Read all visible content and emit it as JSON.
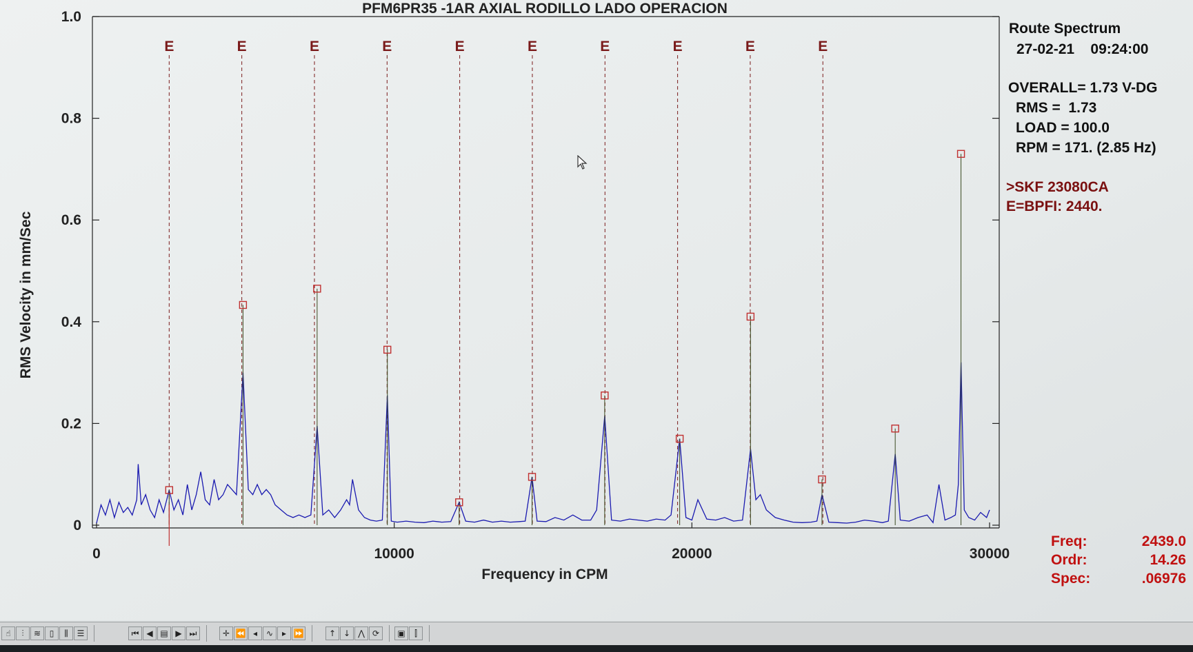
{
  "chart_data": {
    "type": "line",
    "title": "PFM6PR35  -1AR   AXIAL RODILLO LADO OPERACION",
    "xlabel": "Frequency in CPM",
    "ylabel": "RMS Velocity in mm/Sec",
    "xlim": [
      0,
      30000
    ],
    "ylim": [
      0,
      1.0
    ],
    "x_ticks": [
      0,
      10000,
      20000,
      30000
    ],
    "y_ticks": [
      0,
      0.2,
      0.4,
      0.6,
      0.8,
      1.0
    ],
    "x_tick_labels": [
      "0",
      "10000",
      "20000",
      "30000"
    ],
    "y_tick_labels": [
      "0",
      "0.2",
      "0.4",
      "0.6",
      "0.8",
      "1.0"
    ],
    "grid": false,
    "fault_marker_label": "E",
    "fault_frequencies": [
      2440,
      4880,
      7320,
      9760,
      12200,
      14640,
      17080,
      19520,
      21960,
      24400
    ],
    "peaks": [
      {
        "x": 2440,
        "y": 0.069
      },
      {
        "x": 4920,
        "y": 0.433
      },
      {
        "x": 7410,
        "y": 0.465
      },
      {
        "x": 9770,
        "y": 0.345
      },
      {
        "x": 12180,
        "y": 0.045
      },
      {
        "x": 14630,
        "y": 0.095
      },
      {
        "x": 17070,
        "y": 0.255
      },
      {
        "x": 19590,
        "y": 0.17
      },
      {
        "x": 21970,
        "y": 0.41
      },
      {
        "x": 24370,
        "y": 0.09
      },
      {
        "x": 26830,
        "y": 0.19
      },
      {
        "x": 29040,
        "y": 0.73
      }
    ],
    "series": [
      {
        "color": "#1a1ab0",
        "x": [
          0,
          150,
          300,
          450,
          600,
          750,
          900,
          1050,
          1200,
          1350,
          1400,
          1500,
          1650,
          1800,
          1950,
          2100,
          2250,
          2440,
          2600,
          2750,
          2900,
          3050,
          3200,
          3350,
          3500,
          3650,
          3800,
          3950,
          4100,
          4250,
          4400,
          4550,
          4700,
          4920,
          5100,
          5250,
          5400,
          5550,
          5700,
          5850,
          6000,
          6200,
          6400,
          6600,
          6800,
          7000,
          7200,
          7410,
          7600,
          7800,
          8000,
          8200,
          8400,
          8500,
          8600,
          8800,
          9000,
          9200,
          9400,
          9600,
          9770,
          9900,
          10100,
          10400,
          10700,
          11000,
          11300,
          11600,
          11900,
          12180,
          12400,
          12700,
          13000,
          13300,
          13600,
          13900,
          14200,
          14400,
          14630,
          14800,
          15100,
          15400,
          15700,
          16000,
          16300,
          16600,
          16800,
          17070,
          17300,
          17600,
          17900,
          18200,
          18500,
          18800,
          19100,
          19300,
          19590,
          19800,
          20000,
          20200,
          20500,
          20800,
          21100,
          21400,
          21700,
          21970,
          22150,
          22300,
          22500,
          22800,
          23100,
          23400,
          23700,
          24000,
          24200,
          24370,
          24600,
          24900,
          25200,
          25500,
          25800,
          26100,
          26400,
          26600,
          26830,
          27000,
          27300,
          27600,
          27900,
          28100,
          28300,
          28500,
          28700,
          28850,
          28950,
          29040,
          29150,
          29300,
          29500,
          29700,
          29900,
          30000
        ],
        "values": [
          0.004,
          0.04,
          0.02,
          0.05,
          0.015,
          0.045,
          0.025,
          0.035,
          0.02,
          0.05,
          0.12,
          0.04,
          0.06,
          0.03,
          0.015,
          0.05,
          0.025,
          0.069,
          0.03,
          0.05,
          0.02,
          0.08,
          0.03,
          0.06,
          0.105,
          0.05,
          0.04,
          0.09,
          0.05,
          0.06,
          0.08,
          0.07,
          0.06,
          0.3,
          0.07,
          0.06,
          0.08,
          0.06,
          0.07,
          0.06,
          0.04,
          0.03,
          0.02,
          0.015,
          0.02,
          0.015,
          0.02,
          0.195,
          0.02,
          0.03,
          0.015,
          0.03,
          0.05,
          0.04,
          0.09,
          0.03,
          0.015,
          0.01,
          0.008,
          0.01,
          0.255,
          0.008,
          0.006,
          0.008,
          0.006,
          0.005,
          0.008,
          0.006,
          0.007,
          0.045,
          0.008,
          0.006,
          0.01,
          0.006,
          0.008,
          0.006,
          0.007,
          0.008,
          0.095,
          0.008,
          0.007,
          0.015,
          0.01,
          0.02,
          0.01,
          0.01,
          0.03,
          0.215,
          0.01,
          0.008,
          0.012,
          0.01,
          0.008,
          0.012,
          0.01,
          0.02,
          0.17,
          0.015,
          0.01,
          0.05,
          0.012,
          0.01,
          0.015,
          0.008,
          0.01,
          0.15,
          0.05,
          0.06,
          0.03,
          0.015,
          0.01,
          0.006,
          0.005,
          0.006,
          0.008,
          0.06,
          0.006,
          0.005,
          0.004,
          0.006,
          0.01,
          0.008,
          0.005,
          0.008,
          0.14,
          0.01,
          0.008,
          0.015,
          0.02,
          0.005,
          0.08,
          0.01,
          0.015,
          0.02,
          0.08,
          0.32,
          0.03,
          0.015,
          0.01,
          0.025,
          0.015,
          0.03
        ]
      }
    ]
  },
  "info": {
    "heading": "Route Spectrum",
    "datetime": "27-02-21    09:24:00",
    "overall": "OVERALL= 1.73 V-DG",
    "rms": "RMS =  1.73",
    "load": "LOAD = 100.0",
    "rpm": "RPM = 171. (2.85 Hz)",
    "bearing": ">SKF 23080CA",
    "fault_def": "E=BPFI: 2440."
  },
  "cursor": {
    "freq_label": "Freq:",
    "freq_value": "2439.0",
    "ordr_label": "Ordr:",
    "ordr_value": "14.26",
    "spec_label": "Spec:",
    "spec_value": ".06976",
    "x": 2440
  },
  "colors": {
    "spectrum": "#1a1ab0",
    "fault_line": "#7a1a1a",
    "marker": "#c03030",
    "cursor_text": "#c01010",
    "axis": "#222222"
  },
  "toolbar": {
    "groups": [
      [
        "hand-icon",
        "spectrum-icon",
        "waterfall-icon",
        "select-icon",
        "multi-icon",
        "list-icon"
      ],
      [
        "first-icon",
        "prev-icon",
        "page-icon",
        "next-icon",
        "last-icon"
      ],
      [
        "cursor-icon",
        "step-first-icon",
        "step-prev-icon",
        "harmonic-icon",
        "step-next-icon",
        "step-last-icon"
      ],
      [
        "up-icon",
        "down-icon",
        "peak-icon",
        "refresh-icon"
      ],
      [
        "zoom-icon",
        "stats-icon"
      ]
    ]
  }
}
